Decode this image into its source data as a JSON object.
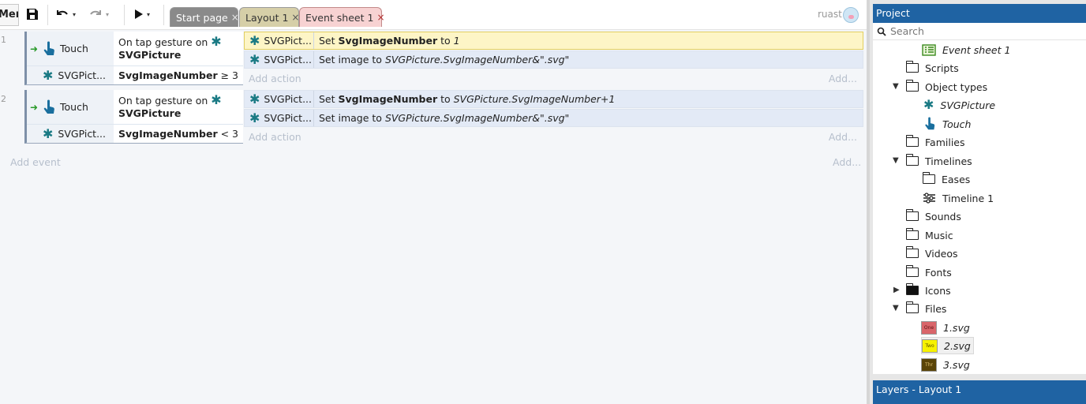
{
  "toolbar": {
    "menu_label": "Menu",
    "undo_caret": "▾",
    "redo_caret": "▾",
    "play_caret": "▾",
    "user": "ruast"
  },
  "tabs": [
    {
      "label": "Start page",
      "close": "×"
    },
    {
      "label": "Layout 1",
      "close": "×"
    },
    {
      "label": "Event sheet 1",
      "close": "×"
    }
  ],
  "events": [
    {
      "number": "1",
      "conditions": [
        {
          "object": "Touch",
          "text_pre": "On tap gesture on",
          "text_obj": "SVGPicture"
        },
        {
          "object": "SVGPict...",
          "text_bold": "SvgImageNumber",
          "text_rest": " ≥ 3"
        }
      ],
      "actions": [
        {
          "object": "SVGPict...",
          "pre": "Set ",
          "bold": "SvgImageNumber",
          "mid": " to ",
          "italic": "1"
        },
        {
          "object": "SVGPict...",
          "pre": "Set image to ",
          "italic": "SVGPicture.SvgImageNumber&\".svg\""
        }
      ],
      "add_action": "Add action",
      "add_right": "Add..."
    },
    {
      "number": "2",
      "conditions": [
        {
          "object": "Touch",
          "text_pre": "On tap gesture on",
          "text_obj": "SVGPicture"
        },
        {
          "object": "SVGPict...",
          "text_bold": "SvgImageNumber",
          "text_rest": " < 3"
        }
      ],
      "actions": [
        {
          "object": "SVGPict...",
          "pre": "Set ",
          "bold": "SvgImageNumber",
          "mid": " to ",
          "italic": "SVGPicture.SvgImageNumber+1"
        },
        {
          "object": "SVGPict...",
          "pre": "Set image to ",
          "italic": "SVGPicture.SvgImageNumber&\".svg\""
        }
      ],
      "add_action": "Add action",
      "add_right": "Add..."
    }
  ],
  "add_event": "Add event",
  "add_event_right": "Add...",
  "project": {
    "title": "Project",
    "search_placeholder": "Search",
    "items": {
      "event_sheet": "Event sheet 1",
      "scripts": "Scripts",
      "object_types": "Object types",
      "svgpicture": "SVGPicture",
      "touch": "Touch",
      "families": "Families",
      "timelines": "Timelines",
      "eases": "Eases",
      "timeline1": "Timeline 1",
      "sounds": "Sounds",
      "music": "Music",
      "videos": "Videos",
      "fonts": "Fonts",
      "icons": "Icons",
      "files": "Files",
      "file1": "1.svg",
      "file2": "2.svg",
      "file3": "3.svg"
    },
    "thumbs": {
      "one": "One",
      "two": "Two",
      "three": "Thr"
    },
    "layers_title": "Layers - Layout 1"
  },
  "colors": {
    "accent": "#1f63a3",
    "selected_action": "#fdf5c6",
    "behavior_icon": "#1a7a84"
  }
}
